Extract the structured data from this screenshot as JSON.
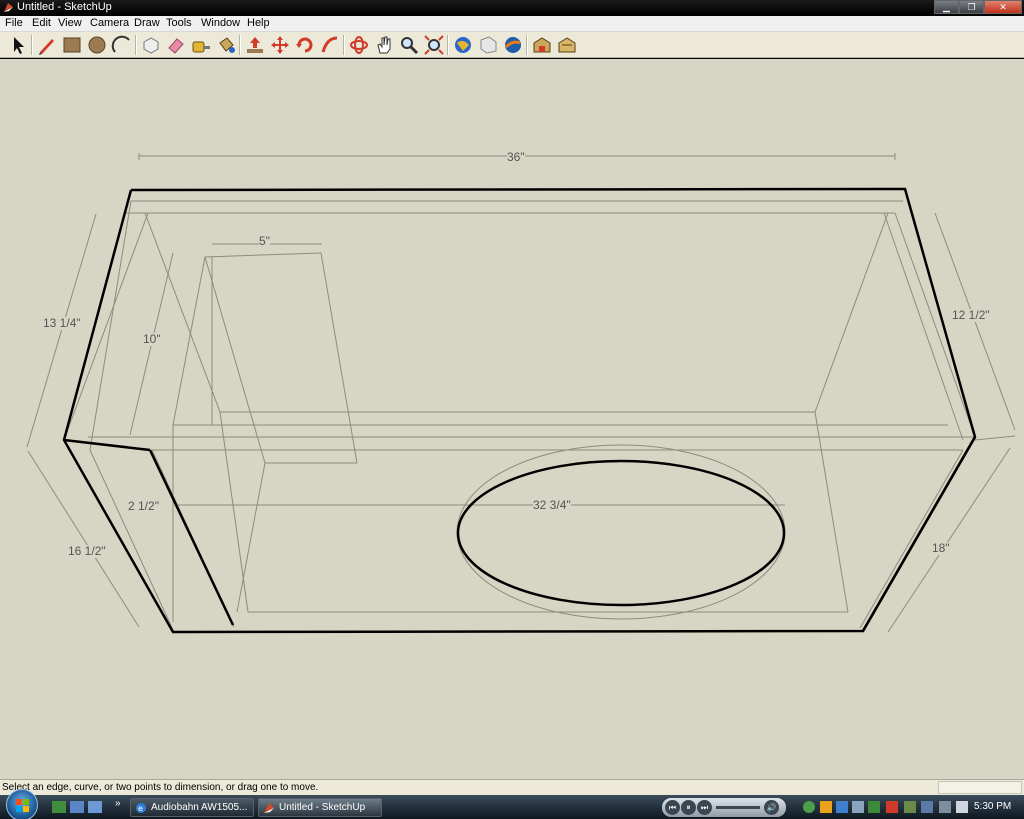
{
  "window": {
    "title": "Untitled - SketchUp"
  },
  "menu": [
    "File",
    "Edit",
    "View",
    "Camera",
    "Draw",
    "Tools",
    "Window",
    "Help"
  ],
  "toolbar": {
    "tools": [
      "select-icon",
      "pencil-icon",
      "rectangle-icon",
      "circle-icon",
      "arc-icon",
      "make-component-icon",
      "eraser-icon",
      "tape-measure-icon",
      "paint-bucket-icon",
      "push-pull-icon",
      "move-icon",
      "rotate-icon",
      "follow-me-icon",
      "orbit-icon",
      "pan-icon",
      "zoom-icon",
      "zoom-extents-icon",
      "get-models-icon",
      "share-model-icon",
      "google-earth-icon",
      "warehouse-icon",
      "components-icon"
    ]
  },
  "dimensions": {
    "top": "36\"",
    "left_height": "13 1/4\"",
    "right_height": "12 1/2\"",
    "port_width": "5\"",
    "port_height": "10\"",
    "wall": "2 1/2\"",
    "inner_width": "32 3/4\"",
    "depth_left": "16 1/2\"",
    "depth_right": "18\""
  },
  "status": {
    "text": "Select an edge, curve, or two points to dimension, or drag one to move."
  },
  "taskbar": {
    "items": [
      {
        "label": "Audiobahn AW1505...",
        "icon": "ie-icon"
      },
      {
        "label": "Untitled - SketchUp",
        "icon": "sketchup-icon"
      }
    ],
    "clock": "5:30 PM"
  }
}
